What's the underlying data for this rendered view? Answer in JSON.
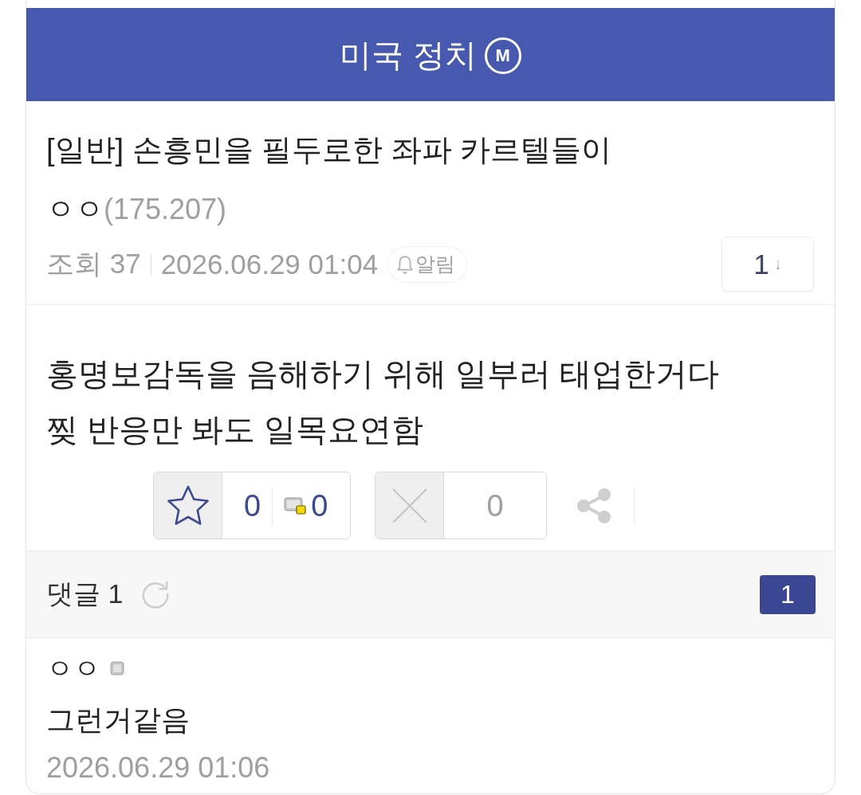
{
  "gallery": {
    "title": "미국 정치",
    "mark": "M"
  },
  "post": {
    "title": "[일반] 손흥민을 필두로한 좌파 카르텔들이",
    "author": {
      "nickname": "ㅇㅇ",
      "ip": "(175.207)"
    },
    "views": "조회 37",
    "date": "2026.06.29 01:04",
    "alert_label": "알림",
    "comment_jump": {
      "count": "1",
      "arrow": "↓"
    },
    "body": [
      "홍명보감독을 음해하기 위해 일부러 태업한거다",
      "찢 반응만 봐도 일목요연함"
    ]
  },
  "votes": {
    "recommend": {
      "count": "0",
      "fixed_count": "0"
    },
    "nonrecommend": {
      "count": "0"
    }
  },
  "comments": {
    "label": "댓글 1",
    "count_badge": "1",
    "items": [
      {
        "nickname": "ㅇㅇ",
        "text": "그런거같음",
        "date": "2026.06.29 01:06"
      }
    ]
  }
}
